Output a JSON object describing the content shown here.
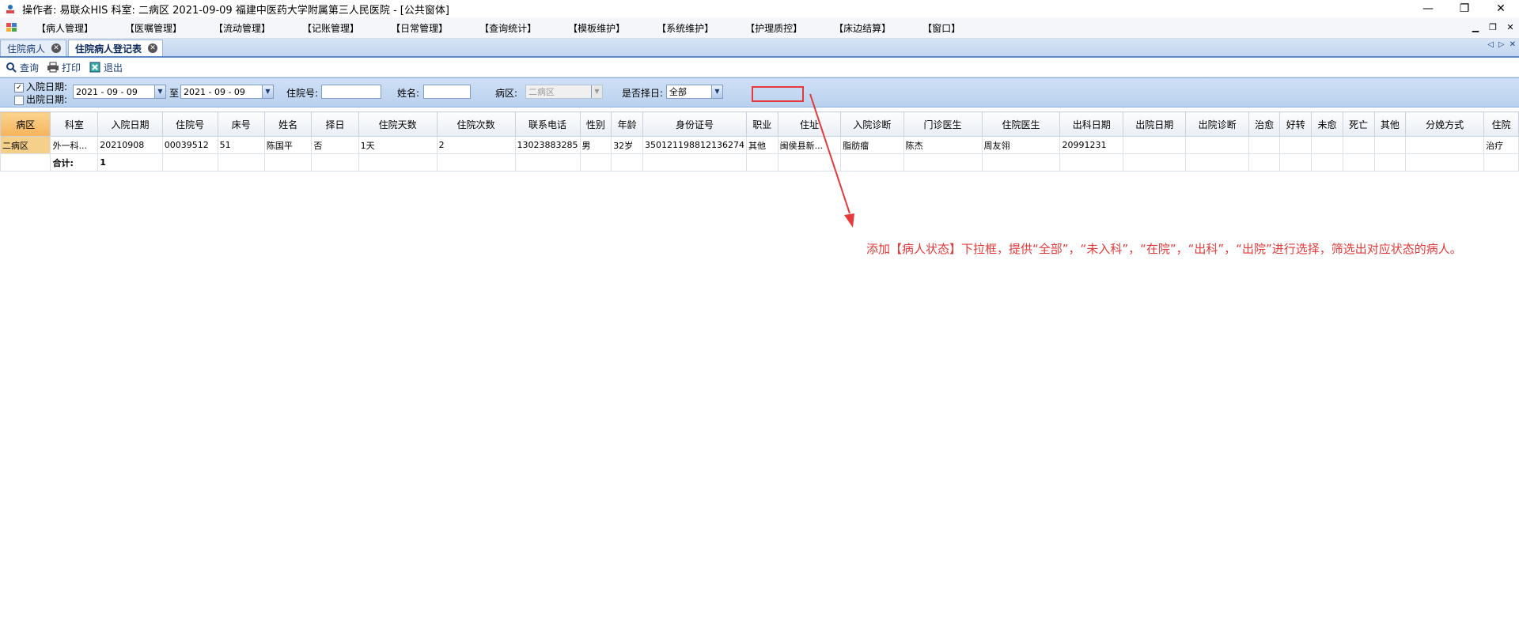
{
  "window": {
    "title": "操作者: 易联众HIS  科室: 二病区  2021-09-09  福建中医药大学附属第三人民医院 - [公共窗体]"
  },
  "menu": [
    "【病人管理】",
    "【医嘱管理】",
    "【流动管理】",
    "【记账管理】",
    "【日常管理】",
    "【查询统计】",
    "【模板维护】",
    "【系统维护】",
    "【护理质控】",
    "【床边结算】",
    "【窗口】"
  ],
  "tabs": [
    {
      "label": "住院病人",
      "active": false
    },
    {
      "label": "住院病人登记表",
      "active": true
    }
  ],
  "toolbar": {
    "query": "查询",
    "print": "打印",
    "exit": "退出"
  },
  "filter": {
    "admit_label": "入院日期:",
    "discharge_label": "出院日期:",
    "date_from": "2021 - 09 - 09",
    "to_label": "至",
    "date_to": "2021 - 09 - 09",
    "inpatient_no_label": "住院号:",
    "name_label": "姓名:",
    "ward_label": "病区:",
    "ward_value": "二病区",
    "choose_day_label": "是否择日:",
    "choose_day_value": "全部"
  },
  "table": {
    "columns": [
      "病区",
      "科室",
      "入院日期",
      "住院号",
      "床号",
      "姓名",
      "择日",
      "住院天数",
      "住院次数",
      "联系电话",
      "性别",
      "年龄",
      "身份证号",
      "职业",
      "住址",
      "入院诊断",
      "门诊医生",
      "住院医生",
      "出科日期",
      "出院日期",
      "出院诊断",
      "治愈",
      "好转",
      "未愈",
      "死亡",
      "其他",
      "分娩方式",
      "住院"
    ],
    "rows": [
      [
        "二病区",
        "外一科...",
        "20210908",
        "00039512",
        "51",
        "陈国平",
        "否",
        "1天",
        "2",
        "13023883285",
        "男",
        "32岁",
        "350121198812136274",
        "其他",
        "闽侯县新...",
        "脂肪瘤",
        "陈杰",
        "周友翎",
        "20991231",
        "",
        "",
        "",
        "",
        "",
        "",
        "",
        "",
        "治疗"
      ]
    ],
    "total_label": "合计:",
    "total_value": "1"
  },
  "annotation": "添加【病人状态】下拉框，提供“全部”，“未入科”，“在院”，“出科”，“出院”进行选择，筛选出对应状态的病人。",
  "colors": {
    "annotation": "#e53a3a",
    "header_selected": "#f5b35b",
    "filterbar": "#c4d8f1"
  }
}
